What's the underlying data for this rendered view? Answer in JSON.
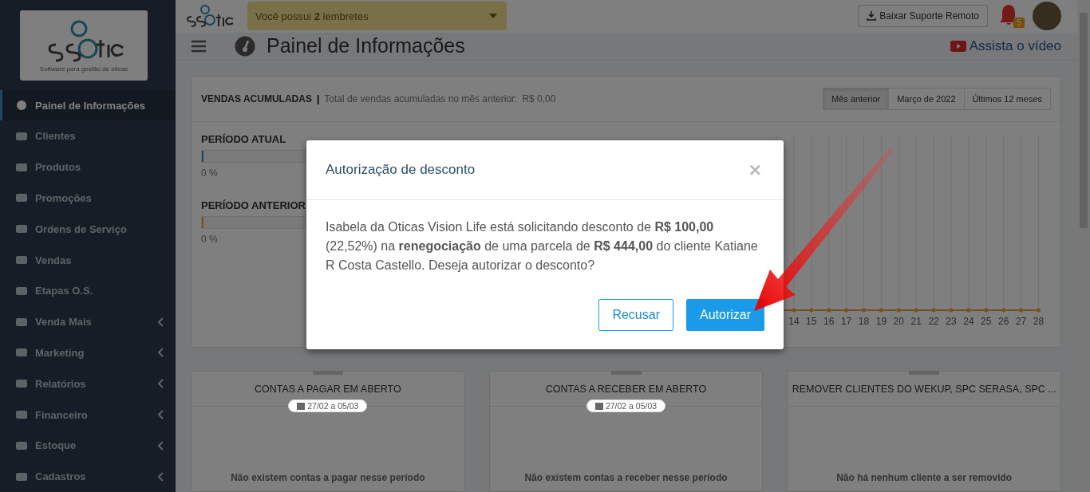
{
  "sidebar": {
    "logo_tagline": "Software para gestão de óticas",
    "items": [
      {
        "label": "Painel de Informações",
        "selected": true,
        "has_submenu": false
      },
      {
        "label": "Clientes",
        "selected": false,
        "has_submenu": false
      },
      {
        "label": "Produtos",
        "selected": false,
        "has_submenu": false
      },
      {
        "label": "Promoções",
        "selected": false,
        "has_submenu": false
      },
      {
        "label": "Ordens de Serviço",
        "selected": false,
        "has_submenu": false
      },
      {
        "label": "Vendas",
        "selected": false,
        "has_submenu": false
      },
      {
        "label": "Etapas O.S.",
        "selected": false,
        "has_submenu": false
      },
      {
        "label": "Venda Mais",
        "selected": false,
        "has_submenu": true
      },
      {
        "label": "Marketing",
        "selected": false,
        "has_submenu": true
      },
      {
        "label": "Relatórios",
        "selected": false,
        "has_submenu": true
      },
      {
        "label": "Financeiro",
        "selected": false,
        "has_submenu": true
      },
      {
        "label": "Estoque",
        "selected": false,
        "has_submenu": true
      },
      {
        "label": "Cadastros",
        "selected": false,
        "has_submenu": true
      }
    ]
  },
  "topbar": {
    "reminders": "Você possui **2** lembretes",
    "download_button": "Baixar Suporte Remoto",
    "notification_count": "5"
  },
  "page": {
    "title": "Painel de Informações",
    "video_link": "Assista o vídeo"
  },
  "sales_card": {
    "title": "VENDAS ACUMULADAS",
    "separator": "|",
    "subtitle": "Total de vendas acumuladas no mês anterior:",
    "total": "R$ 0,00",
    "periods": [
      {
        "label": "Mês anterior",
        "selected": true
      },
      {
        "label": "Março de 2022",
        "selected": false
      },
      {
        "label": "Últimos 12 meses",
        "selected": false
      }
    ],
    "progress": [
      {
        "label": "PERÍODO ATUAL",
        "level": 0,
        "reading": "0 %"
      },
      {
        "label": "PERÍODO ANTERIOR",
        "level": 0,
        "reading": "0 %"
      }
    ],
    "chart_day_labels": [
      "14",
      "15",
      "16",
      "17",
      "18",
      "19",
      "20",
      "21",
      "22",
      "23",
      "24",
      "25",
      "26",
      "27",
      "28"
    ]
  },
  "cards": [
    {
      "title": "CONTAS A PAGAR EM ABERTO",
      "date": "27/02 a 05/03",
      "message": "Não existem contas a pagar nesse período"
    },
    {
      "title": "CONTAS A RECEBER EM ABERTO",
      "date": "27/02 a 05/03",
      "message": "Não existem contas a receber nesse período"
    },
    {
      "title": "REMOVER CLIENTES DO WEKUP, SPC SERASA, SPC ...",
      "message": "Não há nenhum cliente a ser removido"
    }
  ],
  "modal": {
    "title": "Autorização de desconto",
    "close": "×",
    "message": "Isabela da Oticas Vision Life está solicitando desconto de **R$ 100,00** (22,52%) na **renegociação** de uma parcela de **R$ 444,00** do cliente Katiane R Costa Castello. Deseja autorizar o desconto?",
    "buttons": [
      {
        "label": "Recusar",
        "kind": "outline"
      },
      {
        "label": "Autorizar",
        "kind": "primary"
      }
    ]
  }
}
